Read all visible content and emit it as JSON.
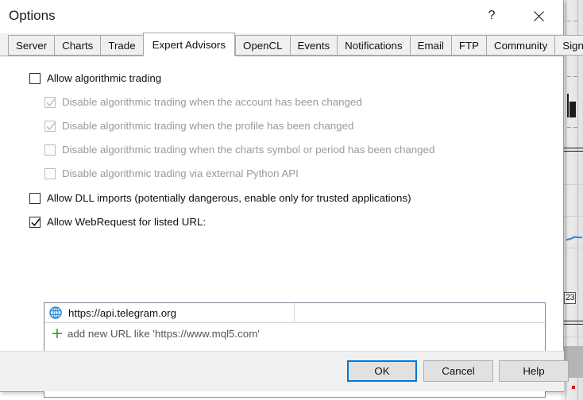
{
  "window": {
    "title": "Options",
    "help_icon": "question-mark-icon",
    "close_icon": "close-icon"
  },
  "tabs": [
    {
      "label": "Server",
      "active": false
    },
    {
      "label": "Charts",
      "active": false
    },
    {
      "label": "Trade",
      "active": false
    },
    {
      "label": "Expert Advisors",
      "active": true
    },
    {
      "label": "OpenCL",
      "active": false
    },
    {
      "label": "Events",
      "active": false
    },
    {
      "label": "Notifications",
      "active": false
    },
    {
      "label": "Email",
      "active": false
    },
    {
      "label": "FTP",
      "active": false
    },
    {
      "label": "Community",
      "active": false
    },
    {
      "label": "Signals",
      "active": false
    }
  ],
  "options": [
    {
      "label": "Allow algorithmic trading",
      "checked": false,
      "disabled": false,
      "indent": 0
    },
    {
      "label": "Disable algorithmic trading when the account has been changed",
      "checked": true,
      "disabled": true,
      "indent": 1
    },
    {
      "label": "Disable algorithmic trading when the profile has been changed",
      "checked": true,
      "disabled": true,
      "indent": 1
    },
    {
      "label": "Disable algorithmic trading when the charts symbol or period has been changed",
      "checked": false,
      "disabled": true,
      "indent": 1
    },
    {
      "label": "Disable algorithmic trading via external Python API",
      "checked": false,
      "disabled": true,
      "indent": 1
    },
    {
      "label": "Allow DLL imports (potentially dangerous, enable only for trusted applications)",
      "checked": false,
      "disabled": false,
      "indent": 0
    },
    {
      "label": "Allow WebRequest for listed URL:",
      "checked": true,
      "disabled": false,
      "indent": 0
    }
  ],
  "url_list": {
    "rows": [
      {
        "icon": "globe-icon",
        "url": "https://api.telegram.org",
        "second_column": ""
      }
    ],
    "add_row": {
      "icon": "plus-icon",
      "text": "add new URL like 'https://www.mql5.com'"
    }
  },
  "footer": {
    "ok_label": "OK",
    "cancel_label": "Cancel",
    "help_label": "Help"
  },
  "background_chart": {
    "price_label": "23"
  },
  "colors": {
    "accent": "#0078d7",
    "globe": "#2e8bd0",
    "plus": "#22a022",
    "disabled_text": "#9a9a9a",
    "chart_red": "#d03030",
    "chart_blue": "#3d7fd1"
  }
}
